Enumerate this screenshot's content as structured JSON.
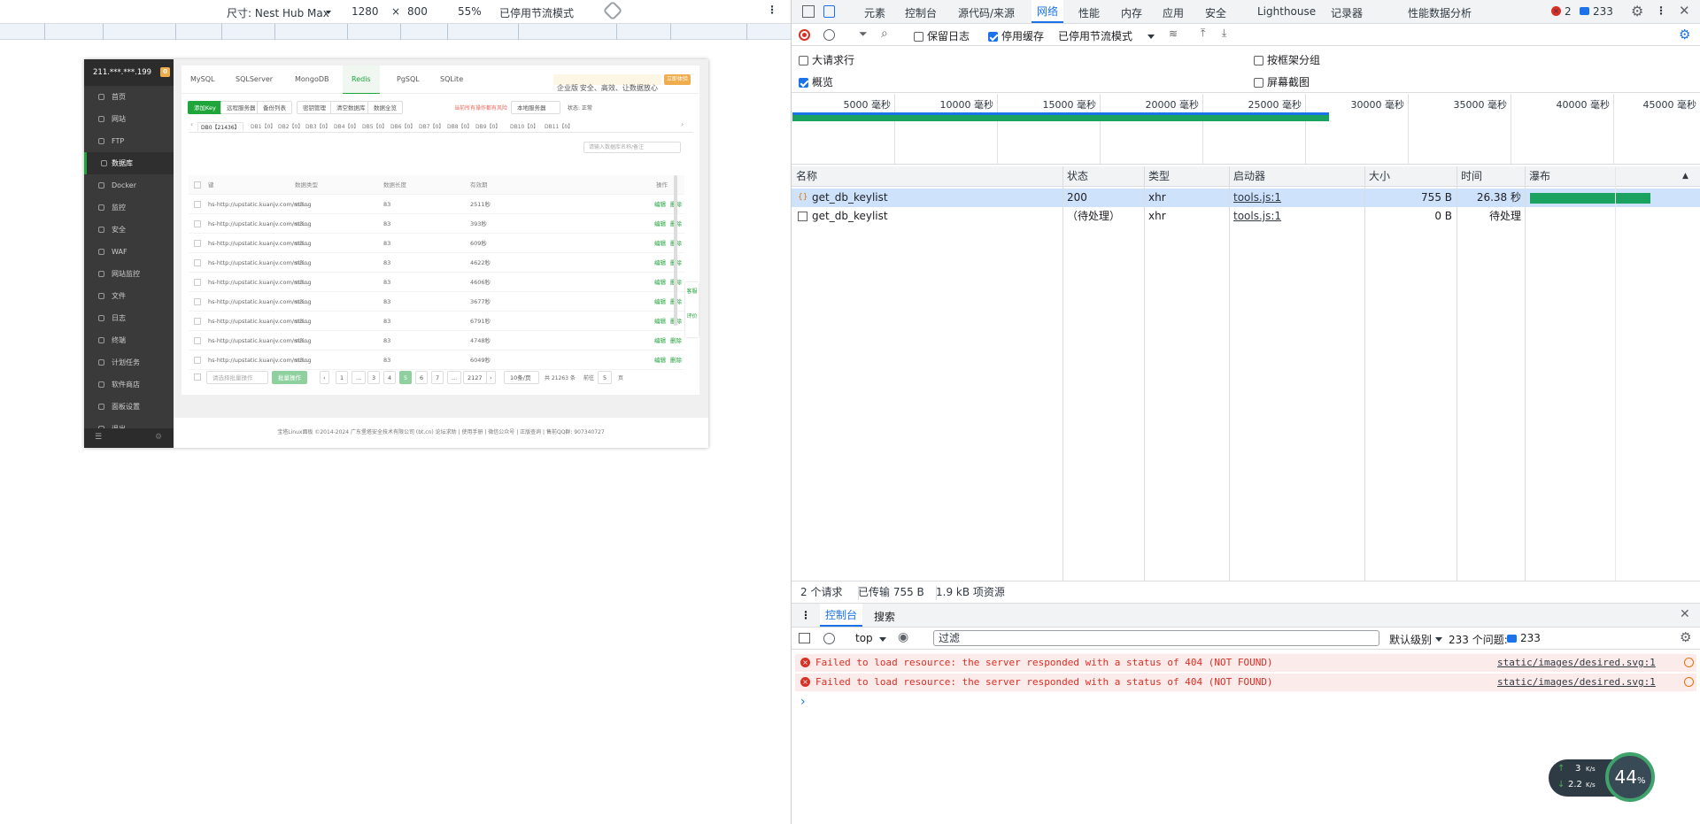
{
  "device_bar": {
    "dimensions_label": "尺寸: Nest Hub Max",
    "width": "1280",
    "times": "×",
    "height": "800",
    "zoom": "55%",
    "throttle": "已停用节流模式",
    "rotate_icon": "rotate-icon",
    "more_icon": "more-vert-icon"
  },
  "panel": {
    "server_ip": "211.***.***.199",
    "alert_count": "0",
    "menu": [
      {
        "label": "首页",
        "icon": "home-icon"
      },
      {
        "label": "网站",
        "icon": "globe-icon"
      },
      {
        "label": "FTP",
        "icon": "ftp-icon"
      },
      {
        "label": "数据库",
        "icon": "database-icon",
        "active": true
      },
      {
        "label": "Docker",
        "icon": "docker-icon"
      },
      {
        "label": "监控",
        "icon": "monitor-icon"
      },
      {
        "label": "安全",
        "icon": "shield-icon"
      },
      {
        "label": "WAF",
        "icon": "waf-icon"
      },
      {
        "label": "网站监控",
        "icon": "site-monitor-icon"
      },
      {
        "label": "文件",
        "icon": "folder-icon"
      },
      {
        "label": "日志",
        "icon": "log-icon"
      },
      {
        "label": "终端",
        "icon": "terminal-icon"
      },
      {
        "label": "计划任务",
        "icon": "clock-icon"
      },
      {
        "label": "软件商店",
        "icon": "store-icon"
      },
      {
        "label": "面板设置",
        "icon": "settings-icon"
      },
      {
        "label": "退出",
        "icon": "logout-icon"
      }
    ],
    "db_tabs": [
      "MySQL",
      "SQLServer",
      "MongoDB",
      "Redis",
      "PgSQL",
      "SQLite"
    ],
    "active_db_tab": "Redis",
    "promo": "安全、高效、让数据放心",
    "promo_button": "立即体验",
    "promo_badge": "企业版",
    "actions": [
      "添加Key",
      "远程服务器",
      "备份列表",
      "密钥管理",
      "清空数据库",
      "数据全览"
    ],
    "warning": "当前所有操作都有风险",
    "server_select": "本地服务器",
    "status_label": "状态: 正常",
    "db_index_tabs": [
      "DB0【21436】",
      "DB1【0】",
      "DB2【0】",
      "DB3【0】",
      "DB4【0】",
      "DB5【0】",
      "DB6【0】",
      "DB7【0】",
      "DB8【0】",
      "DB9【0】",
      "DB10【0】",
      "DB11【0】"
    ],
    "search_placeholder": "请输入数据库名称/备注",
    "table_headers": [
      "键",
      "数据类型",
      "数据长度",
      "有效期",
      "操作"
    ],
    "rows": [
      {
        "key": "hs-http://upstatic.kuanjv.com/m3...",
        "type": "string",
        "len": "83",
        "ttl": "2511秒"
      },
      {
        "key": "hs-http://upstatic.kuanjv.com/m3...",
        "type": "string",
        "len": "83",
        "ttl": "393秒"
      },
      {
        "key": "hs-http://upstatic.kuanjv.com/m3...",
        "type": "string",
        "len": "83",
        "ttl": "609秒"
      },
      {
        "key": "hs-http://upstatic.kuanjv.com/m3...",
        "type": "string",
        "len": "83",
        "ttl": "4622秒"
      },
      {
        "key": "hs-http://upstatic.kuanjv.com/m3...",
        "type": "string",
        "len": "83",
        "ttl": "4606秒"
      },
      {
        "key": "hs-http://upstatic.kuanjv.com/m3...",
        "type": "string",
        "len": "83",
        "ttl": "3677秒"
      },
      {
        "key": "hs-http://upstatic.kuanjv.com/m3...",
        "type": "string",
        "len": "83",
        "ttl": "6791秒"
      },
      {
        "key": "hs-http://upstatic.kuanjv.com/m3...",
        "type": "string",
        "len": "83",
        "ttl": "4748秒"
      },
      {
        "key": "hs-http://upstatic.kuanjv.com/m3...",
        "type": "string",
        "len": "83",
        "ttl": "6049秒"
      }
    ],
    "row_ops": [
      "编辑",
      "删除"
    ],
    "batch_select": "请选择批量操作",
    "batch_button": "批量操作",
    "pages": [
      "1",
      "...",
      "3",
      "4",
      "5",
      "6",
      "7",
      "...",
      "2127"
    ],
    "active_page": "5",
    "per_page": "10条/页",
    "total": "共 21263 条",
    "goto_label": "前往",
    "goto_value": "5",
    "goto_unit": "页",
    "side_float": [
      "客服",
      "评价"
    ],
    "footer": "宝塔Linux面板 ©2014-2024 广东堡塔安全技术有限公司 (bt.cn)   论坛求助  |  使用手册  |  微信公众号  |  正版查询  |  售前QQ群: 907340727"
  },
  "devtools": {
    "tabs": [
      "元素",
      "控制台",
      "源代码/来源",
      "网络",
      "性能",
      "内存",
      "应用",
      "安全",
      "Lighthouse",
      "记录器",
      "性能数据分析"
    ],
    "active_tab": "网络",
    "error_count": "2",
    "issue_count": "233",
    "toolbar": {
      "preserve_log": "保留日志",
      "disable_cache": "停用缓存",
      "throttle": "已停用节流模式"
    },
    "options": {
      "big_rows": "大请求行",
      "group_by_frame": "按框架分组",
      "overview": "概览",
      "screenshots": "屏幕截图"
    },
    "timeline_ticks": [
      "5000 毫秒",
      "10000 毫秒",
      "15000 毫秒",
      "20000 毫秒",
      "25000 毫秒",
      "30000 毫秒",
      "35000 毫秒",
      "40000 毫秒",
      "45000 毫秒"
    ],
    "columns": [
      "名称",
      "状态",
      "类型",
      "启动器",
      "大小",
      "时间",
      "瀑布"
    ],
    "requests": [
      {
        "name": "get_db_keylist",
        "status": "200",
        "type": "xhr",
        "initiator": "tools.js:1",
        "size": "755 B",
        "time": "26.38 秒",
        "icon": "xhr-icon",
        "selected": true
      },
      {
        "name": "get_db_keylist",
        "status": "（待处理）",
        "type": "xhr",
        "initiator": "tools.js:1",
        "size": "0 B",
        "time": "待处理",
        "icon": "document-icon",
        "selected": false
      }
    ],
    "summary": {
      "requests": "2 个请求",
      "transferred": "已传输 755 B",
      "resources": "1.9 kB 项资源"
    },
    "drawer_tabs": [
      "控制台",
      "搜索"
    ],
    "console": {
      "context": "top",
      "filter_placeholder": "过滤",
      "level": "默认级别",
      "issues": "233 个问题:",
      "issues_count": "233",
      "messages": [
        {
          "text": "Failed to load resource: the server responded with a status of 404 (NOT FOUND)",
          "source": "static/images/desired.svg:1"
        },
        {
          "text": "Failed to load resource: the server responded with a status of 404 (NOT FOUND)",
          "source": "static/images/desired.svg:1"
        }
      ],
      "prompt": "›"
    }
  },
  "net_widget": {
    "up": "3",
    "up_unit": "K/s",
    "down": "2.2",
    "down_unit": "K/s",
    "percent": "44",
    "percent_unit": "%"
  }
}
